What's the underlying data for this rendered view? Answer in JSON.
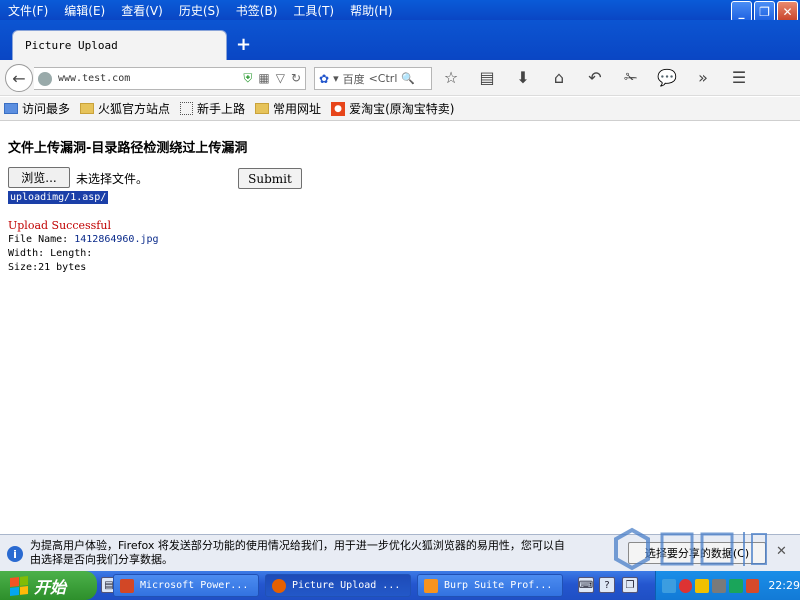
{
  "menu": {
    "items": [
      "文件(F)",
      "编辑(E)",
      "查看(V)",
      "历史(S)",
      "书签(B)",
      "工具(T)",
      "帮助(H)"
    ]
  },
  "window": {
    "minimize": "_",
    "maximize": "❐",
    "close": "✕"
  },
  "tabs": {
    "active_label": "Picture Upload",
    "new_tab": "+"
  },
  "navbar": {
    "url": "www.test.com",
    "search_engine": "百度",
    "search_placeholder": "<Ctrl"
  },
  "bookmarks": {
    "items": [
      "访问最多",
      "火狐官方站点",
      "新手上路",
      "常用网址",
      "爱淘宝(原淘宝特卖)"
    ]
  },
  "page": {
    "title": "文件上传漏洞-目录路径检测绕过上传漏洞",
    "browse_label": "浏览...",
    "no_file": "未选择文件。",
    "submit_label": "Submit",
    "path_value": "uploadimg/1.asp/",
    "upload_status": "Upload Successful",
    "file_name_label": "File Name:",
    "file_name_value": "1412864960.jpg",
    "dimensions": "Width: Length:",
    "size": "Size:21 bytes"
  },
  "notification": {
    "line1": "为提高用户体验，Firefox 将发送部分功能的使用情况给我们，用于进一步优化火狐浏览器的易用性，您可以自",
    "line2": "由选择是否向我们分享数据。",
    "button": "选择要分享的数据(C)"
  },
  "taskbar": {
    "start": "开始",
    "tasks": [
      "Microsoft Power...",
      "Picture Upload ...",
      "Burp Suite Prof..."
    ],
    "clock": "22:29"
  }
}
